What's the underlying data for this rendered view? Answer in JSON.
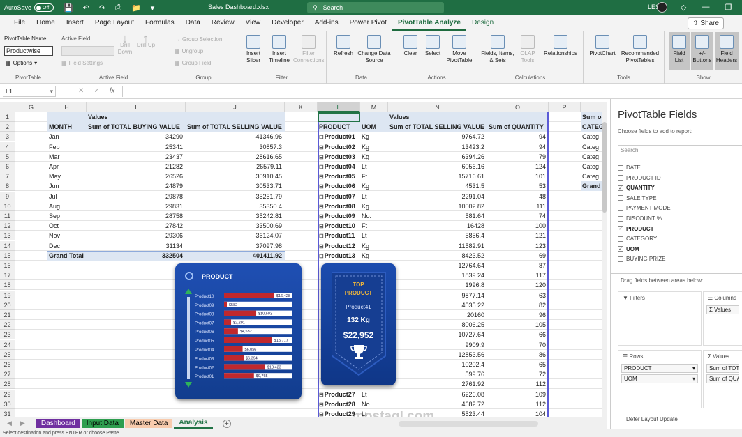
{
  "titlebar": {
    "autosave": "AutoSave",
    "toggle": "Off",
    "filename": "Sales Dashboard.xlsx",
    "search": "Search",
    "user": "LESS"
  },
  "menu": [
    "File",
    "Home",
    "Insert",
    "Page Layout",
    "Formulas",
    "Data",
    "Review",
    "View",
    "Developer",
    "Add-ins",
    "Power Pivot",
    "PivotTable Analyze",
    "Design"
  ],
  "share": "Share",
  "ribbon": {
    "pivottable": {
      "name_label": "PivotTable Name:",
      "name_value": "Productwise",
      "options": "Options",
      "group": "PivotTable"
    },
    "active_field": {
      "label": "Active Field:",
      "drill_down": "Drill Down",
      "drill_up": "Drill Up",
      "field_settings": "Field Settings",
      "group": "Active Field"
    },
    "group": {
      "group_selection": "Group Selection",
      "ungroup": "Ungroup",
      "group_field": "Group Field",
      "group": "Group"
    },
    "filter": {
      "insert_slicer": "Insert Slicer",
      "insert_timeline": "Insert Timeline",
      "filter_connections": "Filter Connections",
      "group": "Filter"
    },
    "data": {
      "refresh": "Refresh",
      "change_source": "Change Data Source",
      "group": "Data"
    },
    "actions": {
      "clear": "Clear",
      "select": "Select",
      "move": "Move PivotTable",
      "group": "Actions"
    },
    "calculations": {
      "fields": "Fields, Items, & Sets",
      "olap": "OLAP Tools",
      "relationships": "Relationships",
      "group": "Calculations"
    },
    "tools": {
      "pivotchart": "PivotChart",
      "recommended": "Recommended PivotTables",
      "group": "Tools"
    },
    "show": {
      "field_list": "Field List",
      "buttons": "+/- Buttons",
      "headers": "Field Headers",
      "group": "Show"
    }
  },
  "formula": {
    "namebox": "L1",
    "fx": "fx"
  },
  "columns": [
    "G",
    "H",
    "I",
    "J",
    "K",
    "L",
    "M",
    "N",
    "O",
    "P"
  ],
  "rows": [
    "1",
    "2",
    "3",
    "4",
    "5",
    "6",
    "7",
    "8",
    "9",
    "10",
    "11",
    "12",
    "13",
    "14",
    "15",
    "16",
    "17",
    "18",
    "19",
    "20",
    "21",
    "22",
    "23",
    "24",
    "25",
    "26",
    "27",
    "28",
    "29",
    "30",
    "31"
  ],
  "pivot1": {
    "values_label": "Values",
    "headers": [
      "MONTH",
      "Sum of TOTAL BUYING VALUE",
      "Sum of TOTAL SELLING VALUE"
    ],
    "rows": [
      [
        "Jan",
        "34290",
        "41346.96"
      ],
      [
        "Feb",
        "25341",
        "30857.3"
      ],
      [
        "Mar",
        "23437",
        "28616.65"
      ],
      [
        "Apr",
        "21282",
        "26579.11"
      ],
      [
        "May",
        "26526",
        "30910.45"
      ],
      [
        "Jun",
        "24879",
        "30533.71"
      ],
      [
        "Jul",
        "29878",
        "35251.79"
      ],
      [
        "Aug",
        "29831",
        "35350.4"
      ],
      [
        "Sep",
        "28758",
        "35242.81"
      ],
      [
        "Oct",
        "27842",
        "33500.69"
      ],
      [
        "Nov",
        "29306",
        "36124.07"
      ],
      [
        "Dec",
        "31134",
        "37097.98"
      ]
    ],
    "total": [
      "Grand Total",
      "332504",
      "401411.92"
    ]
  },
  "pivot2": {
    "values_label": "Values",
    "headers": [
      "PRODUCT",
      "UOM",
      "Sum of TOTAL SELLING VALUE",
      "Sum of QUANTITY"
    ],
    "rows": [
      [
        "Product01",
        "Kg",
        "9764.72",
        "94"
      ],
      [
        "Product02",
        "Kg",
        "13423.2",
        "94"
      ],
      [
        "Product03",
        "Kg",
        "6394.26",
        "79"
      ],
      [
        "Product04",
        "Lt",
        "6056.16",
        "124"
      ],
      [
        "Product05",
        "Ft",
        "15716.61",
        "101"
      ],
      [
        "Product06",
        "Kg",
        "4531.5",
        "53"
      ],
      [
        "Product07",
        "Lt",
        "2291.04",
        "48"
      ],
      [
        "Product08",
        "Kg",
        "10502.82",
        "111"
      ],
      [
        "Product09",
        "No.",
        "581.64",
        "74"
      ],
      [
        "Product10",
        "Ft",
        "16428",
        "100"
      ],
      [
        "Product11",
        "Lt",
        "5856.4",
        "121"
      ],
      [
        "Product12",
        "Kg",
        "11582.91",
        "123"
      ],
      [
        "Product13",
        "Kg",
        "8423.52",
        "69"
      ],
      [
        "",
        "",
        "12764.64",
        "87"
      ],
      [
        "",
        "",
        "1839.24",
        "117"
      ],
      [
        "",
        "",
        "1996.8",
        "120"
      ],
      [
        "",
        "",
        "9877.14",
        "63"
      ],
      [
        "",
        "",
        "4035.22",
        "82"
      ],
      [
        "",
        "",
        "20160",
        "96"
      ],
      [
        "",
        "",
        "8006.25",
        "105"
      ],
      [
        "",
        "",
        "10727.64",
        "66"
      ],
      [
        "",
        "",
        "9909.9",
        "70"
      ],
      [
        "",
        "",
        "12853.56",
        "86"
      ],
      [
        "",
        "",
        "10202.4",
        "65"
      ],
      [
        "",
        "",
        "599.76",
        "72"
      ],
      [
        "",
        "",
        "2761.92",
        "112"
      ],
      [
        "Product27",
        "Lt",
        "6226.08",
        "109"
      ],
      [
        "Product28",
        "No.",
        "4682.72",
        "112"
      ],
      [
        "Product29",
        "Lt",
        "5523.44",
        "104"
      ]
    ]
  },
  "pivot3": {
    "header": "Sum o",
    "sub": "CATEG",
    "items": [
      "Categ",
      "Categ",
      "Categ",
      "Categ",
      "Categ"
    ],
    "total": "Grand"
  },
  "product_card": {
    "title": "PRODUCT",
    "bars": [
      {
        "name": "Product10",
        "value": 16428,
        "label": "$16,428"
      },
      {
        "name": "Product09",
        "value": 582,
        "label": "$582"
      },
      {
        "name": "Product08",
        "value": 10503,
        "label": "$10,503"
      },
      {
        "name": "Product07",
        "value": 2291,
        "label": "$2,291"
      },
      {
        "name": "Product06",
        "value": 4532,
        "label": "$4,532"
      },
      {
        "name": "Product05",
        "value": 15717,
        "label": "$15,717"
      },
      {
        "name": "Product04",
        "value": 6056,
        "label": "$6,056"
      },
      {
        "name": "Product03",
        "value": 6394,
        "label": "$6,394"
      },
      {
        "name": "Product02",
        "value": 13423,
        "label": "$13,423"
      },
      {
        "name": "Product01",
        "value": 9765,
        "label": "$9,765"
      }
    ]
  },
  "top_card": {
    "line1": "TOP",
    "line2": "PRODUCT",
    "name": "Product41",
    "qty": "132 Kg",
    "value": "$22,952"
  },
  "sheet_tabs": [
    {
      "label": "Dashboard",
      "color": "#7030a0",
      "text": "#ffffff"
    },
    {
      "label": "Input Data",
      "color": "#2e9e4f",
      "text": "#000000"
    },
    {
      "label": "Master Data",
      "color": "#f8cbad",
      "text": "#000000"
    },
    {
      "label": "Analysis",
      "color": "#ffffff",
      "text": "#000000"
    }
  ],
  "status": "Select destination and press ENTER or choose Paste",
  "fields_panel": {
    "title": "PivotTable Fields",
    "subtitle": "Choose fields to add to report:",
    "search": "Search",
    "fields": [
      {
        "label": "DATE",
        "checked": false
      },
      {
        "label": "PRODUCT ID",
        "checked": false
      },
      {
        "label": "QUANTITY",
        "checked": true
      },
      {
        "label": "SALE TYPE",
        "checked": false
      },
      {
        "label": "PAYMENT MODE",
        "checked": false
      },
      {
        "label": "DISCOUNT %",
        "checked": false
      },
      {
        "label": "PRODUCT",
        "checked": true
      },
      {
        "label": "CATEGORY",
        "checked": false
      },
      {
        "label": "UOM",
        "checked": true
      },
      {
        "label": "BUYING PRIZE",
        "checked": false
      }
    ],
    "drag_label": "Drag fields between areas below:",
    "filters": "Filters",
    "columns": "Columns",
    "columns_item": "Σ Values",
    "rows": "Rows",
    "rows_items": [
      "PRODUCT",
      "UOM"
    ],
    "values": "Values",
    "values_items": [
      "Sum of TOTA",
      "Sum of QUA"
    ],
    "defer": "Defer Layout Update"
  },
  "watermark": "mostaql.com"
}
